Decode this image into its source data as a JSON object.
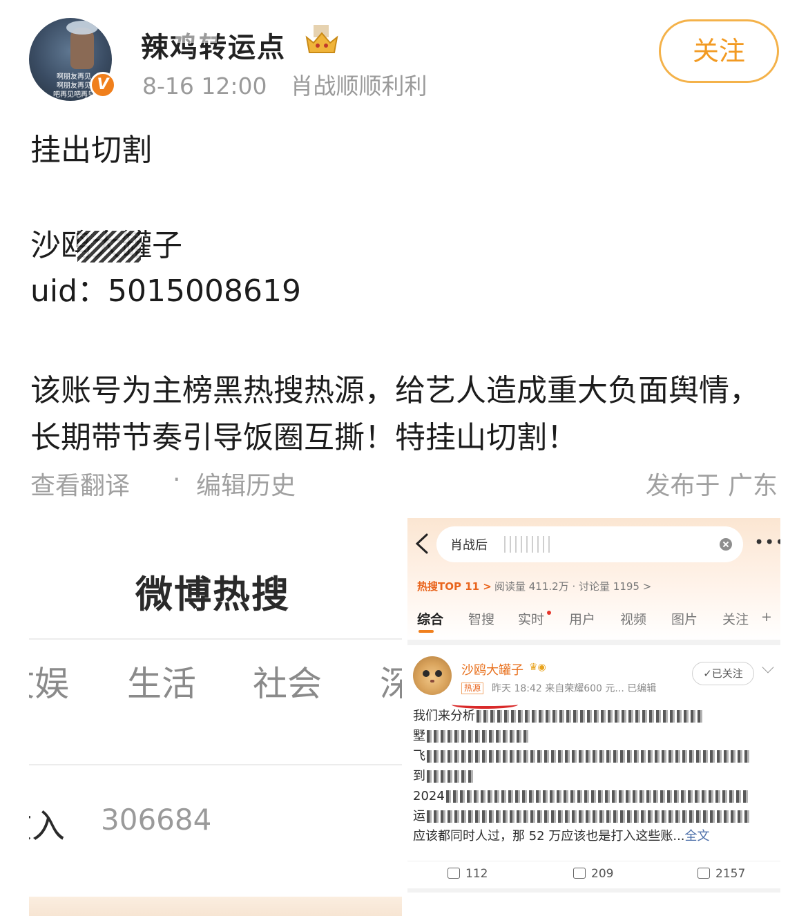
{
  "post": {
    "author": "辣鸡转运点",
    "time": "8-16 12:00",
    "source": "肖战顺顺利利",
    "follow_label": "关注",
    "avatar_caption": [
      "啊朋友再见",
      "啊朋友再见",
      "吧再见吧再见"
    ],
    "verified_badge": "V",
    "lines": [
      "挂出切割",
      "沙鸥大罐子",
      "uid：5015008619",
      "该账号为主榜黑热搜热源，给艺人造成重大负面舆情，长期带节奏引导饭圈互撕！特挂山切割！"
    ],
    "translate_label": "查看翻译",
    "separator": "·",
    "edit_history_label": "编辑历史",
    "location": "发布于 广东"
  },
  "hot_search_panel": {
    "title": "微博热搜",
    "tabs": [
      "文娱",
      "生活",
      "社会",
      "深"
    ],
    "rank_word": "收入",
    "rank_count": "306684"
  },
  "result_screenshot": {
    "query": "肖战后",
    "more_glyph": "•••",
    "top_badge": "热搜TOP 11 >",
    "read_info": "阅读量 411.2万 · 讨论量 1195 >",
    "tabs": [
      "综合",
      "智搜",
      "实时",
      "用户",
      "视频",
      "图片",
      "关注",
      "+"
    ],
    "poster_name": "沙鸥大罐子",
    "poster_crown": "♛◉",
    "hot_tag": "热源",
    "poster_meta": "昨天 18:42  来自荣耀600 元...  已编辑",
    "followed_label": "✓已关注",
    "body_lines": [
      "我们来分析",
      "墅",
      "飞",
      "到",
      "2024",
      "运",
      "应该都同时人过，那 52 万应该也是打入这些账...",
      "全文"
    ],
    "share_count": "112",
    "comment_count": "209",
    "like_count": "2157"
  },
  "icons": {
    "crown": "crown-icon",
    "back": "back-arrow-icon",
    "clear": "clear-icon",
    "more": "more-icon",
    "share": "share-icon",
    "comment": "comment-icon",
    "like": "like-icon"
  },
  "colors": {
    "accent_orange": "#f29a22",
    "follow_border": "#f4b24a",
    "name_orange": "#e8701d",
    "link_blue": "#4a6da8",
    "underline_red": "#d92a2a"
  }
}
